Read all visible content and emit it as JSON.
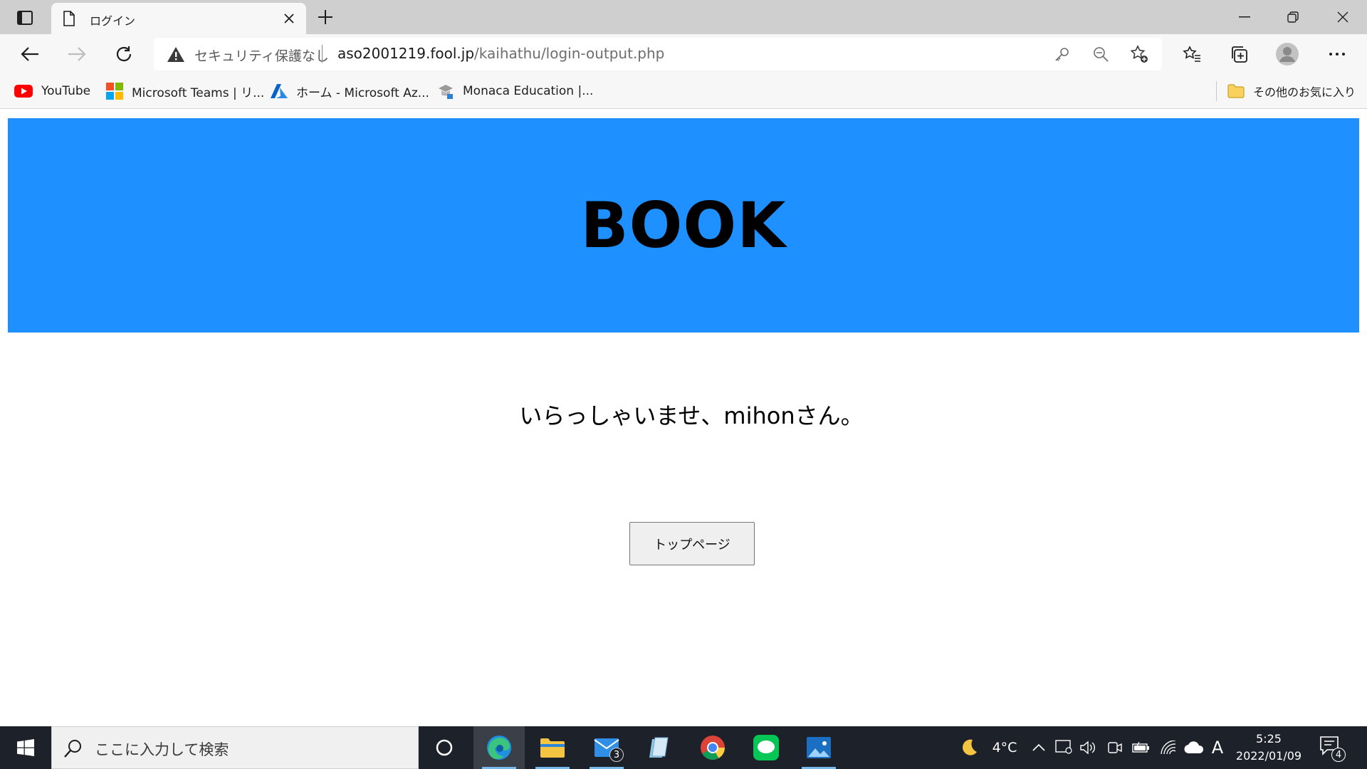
{
  "browser": {
    "tab": {
      "title": "ログイン"
    },
    "omnibox": {
      "security_label": "セキュリティ保護なし",
      "url_host": "aso2001219.fool.jp",
      "url_path": "/kaihathu/login-output.php"
    },
    "favorites": [
      {
        "label": "YouTube",
        "icon": "youtube-icon"
      },
      {
        "label": "Microsoft Teams | リ...",
        "icon": "microsoft-icon"
      },
      {
        "label": "ホーム - Microsoft Az...",
        "icon": "azure-icon"
      },
      {
        "label": "Monaca Education |...",
        "icon": "monaca-icon"
      }
    ],
    "other_favorites": "その他のお気に入り"
  },
  "page": {
    "banner_title": "BOOK",
    "welcome_message": "いらっしゃいませ、mihonさん。",
    "top_button_label": "トップページ"
  },
  "taskbar": {
    "search_placeholder": "ここに入力して検索",
    "mail_badge": "3",
    "temperature": "4°C",
    "ime_indicator": "A",
    "time": "5:25",
    "date": "2022/01/09",
    "notification_count": "4"
  },
  "colors": {
    "banner": "#1e90ff",
    "taskbar": "#1d2129",
    "browser_chrome": "#f7f7f7"
  }
}
